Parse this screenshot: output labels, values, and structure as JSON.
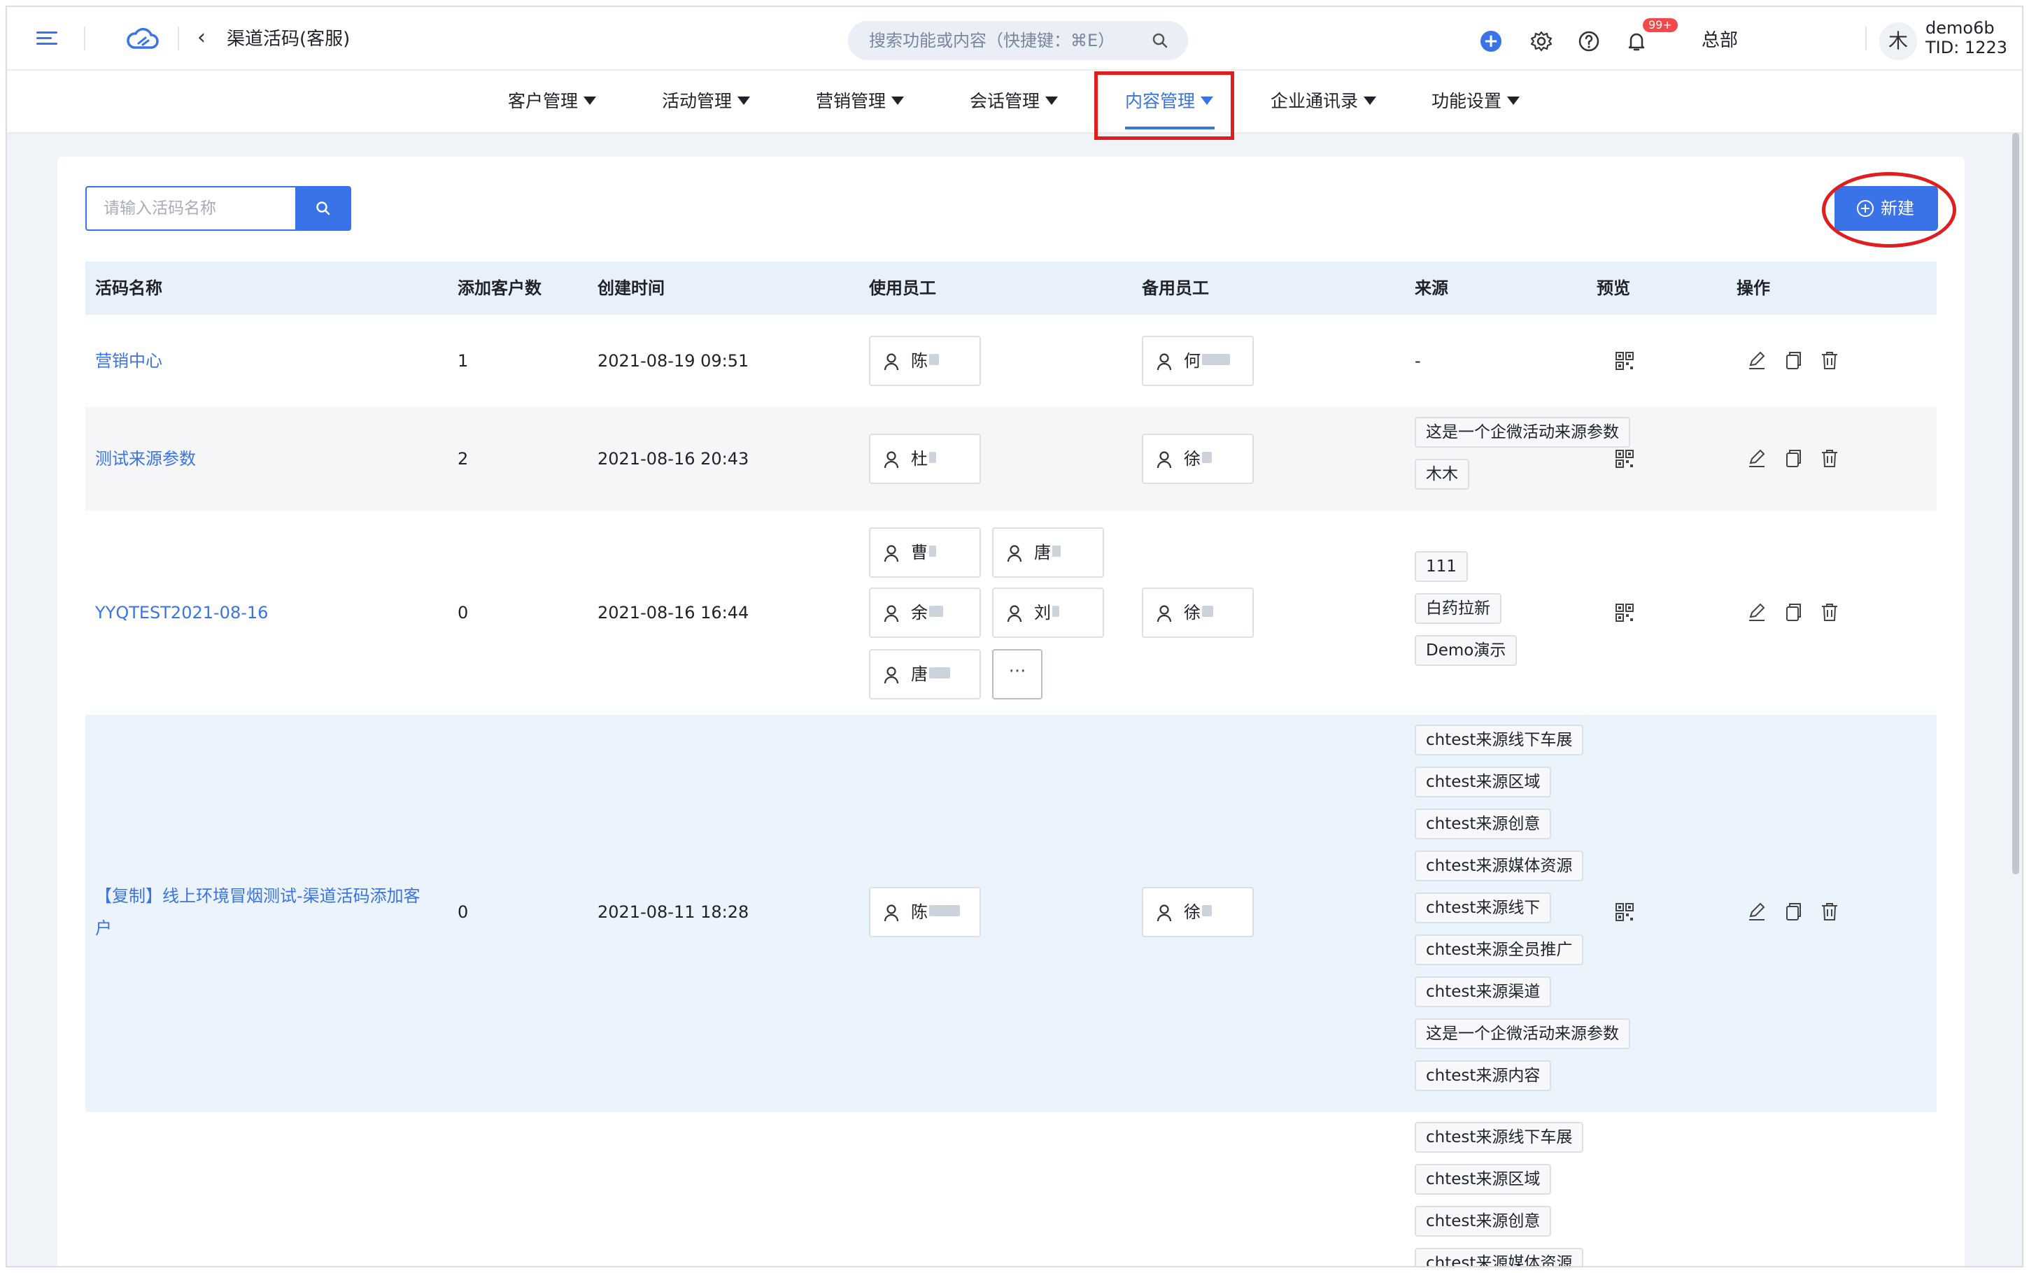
{
  "header": {
    "page_title": "渠道活码(客服)",
    "search_placeholder": "搜索功能或内容（快捷键：⌘E）",
    "badge": "99+",
    "org": "总部",
    "avatar_char": "木",
    "username": "demo6b",
    "tid": "TID: 1223"
  },
  "nav": [
    {
      "label": "客户管理",
      "active": false
    },
    {
      "label": "活动管理",
      "active": false
    },
    {
      "label": "营销管理",
      "active": false
    },
    {
      "label": "会话管理",
      "active": false
    },
    {
      "label": "内容管理",
      "active": true
    },
    {
      "label": "企业通讯录",
      "active": false
    },
    {
      "label": "功能设置",
      "active": false
    }
  ],
  "toolbar": {
    "search_placeholder": "请输入活码名称",
    "new_label": "新建"
  },
  "table": {
    "columns": [
      "活码名称",
      "添加客户数",
      "创建时间",
      "使用员工",
      "备用员工",
      "来源",
      "预览",
      "操作"
    ],
    "rows": [
      {
        "name": "营销中心",
        "count": "1",
        "created": "2021-08-19 09:51",
        "staff": [
          "陈"
        ],
        "backup": [
          "何"
        ],
        "sources": [
          "-"
        ]
      },
      {
        "name": "测试来源参数",
        "count": "2",
        "created": "2021-08-16 20:43",
        "staff": [
          "杜"
        ],
        "backup": [
          "徐"
        ],
        "sources": [
          "这是一个企微活动来源参数",
          "木木"
        ]
      },
      {
        "name": "YYQTEST2021-08-16",
        "count": "0",
        "created": "2021-08-16 16:44",
        "staff": [
          "曹",
          "唐",
          "余",
          "刘",
          "唐"
        ],
        "more": "···",
        "backup": [
          "徐"
        ],
        "sources": [
          "111",
          "白药拉新",
          "Demo演示"
        ]
      },
      {
        "name": "【复制】线上环境冒烟测试-渠道活码添加客户",
        "count": "0",
        "created": "2021-08-11 18:28",
        "staff": [
          "陈"
        ],
        "backup": [
          "徐"
        ],
        "sources": [
          "chtest来源线下车展",
          "chtest来源区域",
          "chtest来源创意",
          "chtest来源媒体资源",
          "chtest来源线下",
          "chtest来源全员推广",
          "chtest来源渠道",
          "这是一个企微活动来源参数",
          "chtest来源内容"
        ]
      },
      {
        "name": "",
        "count": "",
        "created": "",
        "staff": [],
        "backup": [],
        "sources": [
          "chtest来源线下车展",
          "chtest来源区域",
          "chtest来源创意",
          "chtest来源媒体资源"
        ]
      }
    ]
  },
  "colors": {
    "accent": "#3a73e8",
    "annotation_red": "#e11d1d",
    "header_row_bg": "#e8f1fb",
    "highlight_row_bg": "#ebf3fc"
  },
  "icons": [
    "menu-icon",
    "cloud-logo-icon",
    "back-chevron-icon",
    "search-icon",
    "plus-circle-icon",
    "gear-icon",
    "help-icon",
    "bell-icon",
    "person-icon",
    "qrcode-icon",
    "edit-icon",
    "copy-icon",
    "delete-icon"
  ]
}
